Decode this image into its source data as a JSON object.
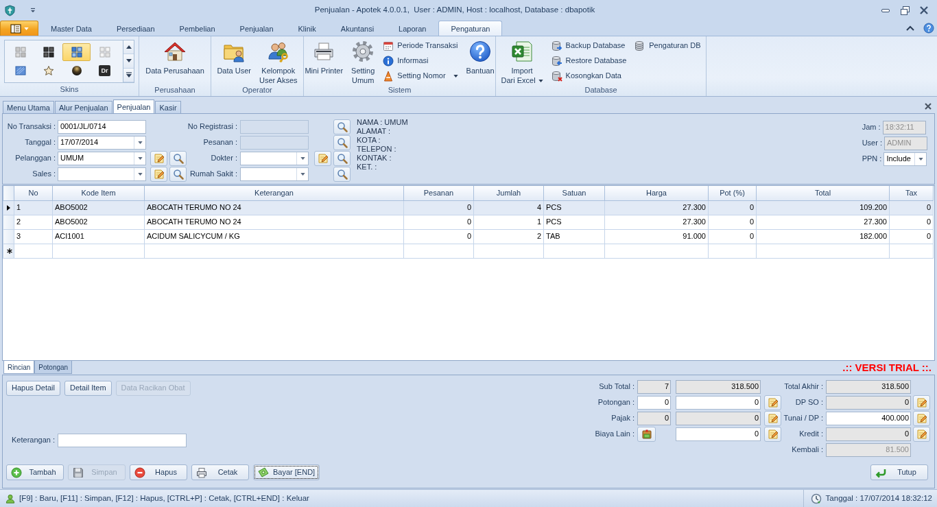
{
  "window": {
    "title": "Penjualan - Apotek 4.0.0.1,  User : ADMIN, Host : localhost, Database : dbapotik"
  },
  "ribbon": {
    "tabs": [
      {
        "label": "Master Data",
        "selected": false
      },
      {
        "label": "Persediaan",
        "selected": false
      },
      {
        "label": "Pembelian",
        "selected": false
      },
      {
        "label": "Penjualan",
        "selected": false
      },
      {
        "label": "Klinik",
        "selected": false
      },
      {
        "label": "Akuntansi",
        "selected": false
      },
      {
        "label": "Laporan",
        "selected": false
      },
      {
        "label": "Pengaturan",
        "selected": true
      }
    ],
    "skins": {
      "label": "Skins",
      "items": [
        {
          "selected": false
        },
        {
          "selected": false
        },
        {
          "selected": true
        },
        {
          "selected": false
        },
        {
          "selected": false
        },
        {
          "selected": false
        },
        {
          "selected": false
        },
        {
          "selected": false,
          "text": "Dr"
        }
      ]
    },
    "groups": [
      {
        "label": "Perusahaan",
        "columns": [
          {
            "kind": "large",
            "label": "Data Perusahaan",
            "dropdown": false
          }
        ]
      },
      {
        "label": "Operator",
        "columns": [
          {
            "kind": "large",
            "label": "Data User",
            "dropdown": false
          },
          {
            "kind": "large",
            "label": "Kelompok\nUser Akses",
            "dropdown": false
          }
        ]
      },
      {
        "label": "Sistem",
        "columns": [
          {
            "kind": "large",
            "label": "Mini Printer",
            "dropdown": false
          },
          {
            "kind": "large",
            "label": "Setting\nUmum",
            "dropdown": false
          },
          {
            "kind": "stack",
            "items": [
              {
                "label": "Periode Transaksi",
                "dropdown": false
              },
              {
                "label": "Informasi",
                "dropdown": false
              },
              {
                "label": "Setting Nomor",
                "dropdown": true
              }
            ]
          },
          {
            "kind": "large",
            "label": "Bantuan",
            "dropdown": false
          }
        ]
      },
      {
        "label": "Database",
        "columns": [
          {
            "kind": "large",
            "label": "Import\nDari Excel",
            "dropdown": true
          },
          {
            "kind": "stack",
            "items": [
              {
                "label": "Backup Database",
                "dropdown": false
              },
              {
                "label": "Restore Database",
                "dropdown": false
              },
              {
                "label": "Kosongkan Data",
                "dropdown": false
              }
            ]
          },
          {
            "kind": "stack",
            "items": [
              {
                "label": "Pengaturan DB",
                "dropdown": false
              }
            ]
          }
        ]
      }
    ]
  },
  "documents": {
    "tabs": [
      {
        "label": "Menu Utama",
        "selected": false
      },
      {
        "label": "Alur Penjualan",
        "selected": false
      },
      {
        "label": "Penjualan",
        "selected": true
      },
      {
        "label": "Kasir",
        "selected": false
      }
    ]
  },
  "header_form": {
    "left": [
      {
        "label": "No Transaksi :",
        "kind": "text",
        "readonly": false,
        "disabled": false,
        "value": "0001/JL/0714"
      },
      {
        "label": "Tanggal :",
        "kind": "combo",
        "readonly": false,
        "disabled": false,
        "value": "17/07/2014"
      },
      {
        "label": "Pelanggan :",
        "kind": "combo",
        "readonly": false,
        "disabled": false,
        "value": "UMUM",
        "actions": [
          {
            "kind": "edit"
          },
          {
            "kind": "search"
          }
        ]
      },
      {
        "label": "Sales :",
        "kind": "combo",
        "readonly": false,
        "disabled": false,
        "actions": [
          {
            "kind": "edit"
          },
          {
            "kind": "search"
          }
        ]
      }
    ],
    "middle": [
      {
        "label": "No Registrasi :",
        "kind": "text",
        "readonly": false,
        "disabled": true,
        "actions": [
          {
            "kind": "search"
          }
        ]
      },
      {
        "label": "Pesanan :",
        "kind": "text",
        "readonly": false,
        "disabled": true,
        "actions": [
          {
            "kind": "search"
          }
        ]
      },
      {
        "label": "Dokter :",
        "kind": "combo",
        "readonly": false,
        "disabled": false,
        "actions": [
          {
            "kind": "edit"
          },
          {
            "kind": "search"
          }
        ]
      },
      {
        "label": "Rumah Sakit :",
        "kind": "combo",
        "readonly": false,
        "disabled": false,
        "actions": [
          {
            "kind": "search"
          }
        ]
      }
    ],
    "customer_info": [
      "NAMA : UMUM",
      "ALAMAT :",
      "KOTA :",
      "TELEPON :",
      "KONTAK :",
      "KET. :"
    ],
    "right": [
      {
        "label": "Jam :",
        "kind": "text",
        "readonly": true,
        "disabled": true,
        "value": "18:32:11"
      },
      {
        "label": "User :",
        "kind": "text",
        "readonly": true,
        "disabled": true,
        "value": "ADMIN"
      },
      {
        "label": "PPN :",
        "kind": "combo",
        "readonly": false,
        "disabled": false,
        "value": "Include"
      }
    ]
  },
  "items_table": {
    "columns": [
      {
        "label": "No",
        "kind": "text"
      },
      {
        "label": "Kode Item",
        "kind": "text"
      },
      {
        "label": "Keterangan",
        "kind": "text"
      },
      {
        "label": "Pesanan",
        "kind": "number"
      },
      {
        "label": "Jumlah",
        "kind": "number"
      },
      {
        "label": "Satuan",
        "kind": "text"
      },
      {
        "label": "Harga",
        "kind": "number"
      },
      {
        "label": "Pot (%)",
        "kind": "number"
      },
      {
        "label": "Total",
        "kind": "number"
      },
      {
        "label": "Tax",
        "kind": "number"
      }
    ],
    "rows": [
      {
        "selected": true,
        "cells": [
          "1",
          "ABO5002",
          "ABOCATH TERUMO NO 24",
          "0",
          "4",
          "PCS",
          "27.300",
          "0",
          "109.200",
          "0"
        ]
      },
      {
        "selected": false,
        "cells": [
          "2",
          "ABO5002",
          "ABOCATH TERUMO NO 24",
          "0",
          "1",
          "PCS",
          "27.300",
          "0",
          "27.300",
          "0"
        ]
      },
      {
        "selected": false,
        "cells": [
          "3",
          "ACI1001",
          "ACIDUM SALICYCUM / KG",
          "0",
          "2",
          "TAB",
          "91.000",
          "0",
          "182.000",
          "0"
        ]
      }
    ],
    "new_row": true
  },
  "detail_tabs": [
    {
      "label": "Rincian",
      "selected": true
    },
    {
      "label": "Potongan",
      "selected": false
    }
  ],
  "trial_notice": ".:: VERSI TRIAL ::.",
  "detail_buttons": [
    {
      "label": "Hapus Detail",
      "disabled": false
    },
    {
      "label": "Detail Item",
      "disabled": false
    },
    {
      "label": "Data Racikan Obat",
      "disabled": true
    }
  ],
  "note": {
    "label": "Keterangan :",
    "readonly": false,
    "disabled": false
  },
  "actions": [
    {
      "label": "Tambah",
      "disabled": false,
      "focused": false
    },
    {
      "label": "Simpan",
      "disabled": true,
      "focused": false
    },
    {
      "label": "Hapus",
      "disabled": false,
      "focused": false
    },
    {
      "label": "Cetak",
      "disabled": false,
      "focused": false
    },
    {
      "label": "Bayar [END]",
      "disabled": false,
      "focused": true
    }
  ],
  "totals": {
    "left": [
      {
        "label": "Sub Total :",
        "count": {
          "readonly": true,
          "disabled": false,
          "value": "7"
        },
        "amount": {
          "readonly": true,
          "disabled": false,
          "value": "318.500"
        },
        "icon_button": false,
        "edit_button": false
      },
      {
        "label": "Potongan :",
        "count": {
          "readonly": false,
          "disabled": false,
          "value": "0"
        },
        "amount": {
          "readonly": false,
          "disabled": false,
          "value": "0"
        },
        "icon_button": false,
        "edit_button": true
      },
      {
        "label": "Pajak :",
        "count": {
          "readonly": true,
          "disabled": false,
          "value": "0"
        },
        "amount": {
          "readonly": true,
          "disabled": false,
          "value": "0"
        },
        "icon_button": false,
        "edit_button": true
      },
      {
        "label": "Biaya Lain :",
        "amount": {
          "readonly": false,
          "disabled": false,
          "value": "0"
        },
        "icon_button": true,
        "edit_button": true
      }
    ],
    "right": [
      {
        "label": "Total Akhir :",
        "amount": {
          "readonly": true,
          "disabled": false,
          "value": "318.500"
        },
        "edit_button": false
      },
      {
        "label": "DP SO :",
        "amount": {
          "readonly": true,
          "disabled": false,
          "value": "0"
        },
        "edit_button": true
      },
      {
        "label": "Tunai / DP :",
        "amount": {
          "readonly": false,
          "disabled": false,
          "value": "400.000"
        },
        "edit_button": true
      },
      {
        "label": "Kredit :",
        "amount": {
          "readonly": true,
          "disabled": false,
          "value": "0"
        },
        "edit_button": true
      },
      {
        "label": "Kembali :",
        "amount": {
          "readonly": true,
          "disabled": true,
          "value": "81.500"
        },
        "edit_button": false
      }
    ]
  },
  "close_button": {
    "label": "Tutup"
  },
  "status_bar": {
    "shortcuts": "[F9] : Baru, [F11] : Simpan, [F12] : Hapus, [CTRL+P] : Cetak, [CTRL+END] : Keluar",
    "datetime": "Tanggal : 17/07/2014 18:32:12"
  }
}
